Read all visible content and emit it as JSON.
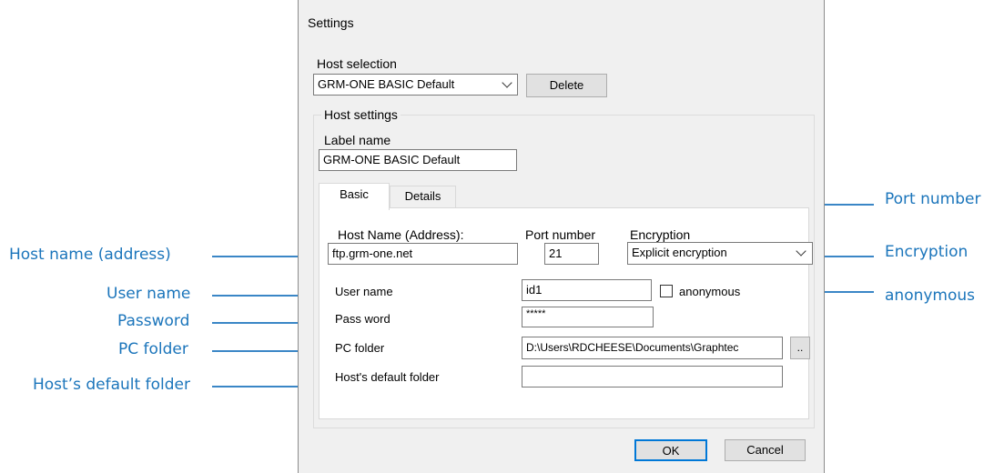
{
  "dialog": {
    "title": "Settings",
    "host_selection_label": "Host selection",
    "host_selection_value": "GRM-ONE BASIC Default",
    "delete_label": "Delete",
    "host_settings_label": "Host settings",
    "label_name_label": "Label name",
    "label_name_value": "GRM-ONE BASIC Default",
    "tabs": [
      {
        "label": "Basic",
        "active": true
      },
      {
        "label": "Details",
        "active": false
      }
    ],
    "host_name_label": "Host Name (Address):",
    "host_name_value": "ftp.grm-one.net",
    "port_label": "Port number",
    "port_value": "21",
    "encryption_label": "Encryption",
    "encryption_value": "Explicit encryption",
    "user_name_label": "User name",
    "user_name_value": "id1",
    "anonymous_label": "anonymous",
    "anonymous_checked": false,
    "password_label": "Pass word",
    "password_value": "*****",
    "pc_folder_label": "PC folder",
    "pc_folder_value": "D:\\Users\\RDCHEESE\\Documents\\Graphtec",
    "browse_label": "..",
    "host_default_folder_label": "Host's default folder",
    "host_default_folder_value": "",
    "ok_label": "OK",
    "cancel_label": "Cancel"
  },
  "callouts": {
    "port_number": "Port number",
    "host_name": "Host name (address)",
    "encryption": "Encryption",
    "user_name": "User name",
    "anonymous": "anonymous",
    "password": "Password",
    "pc_folder": "PC folder",
    "host_default_folder": "Host’s default folder"
  },
  "colors": {
    "callout_text": "#1b75bb",
    "callout_line": "#3a86c6",
    "dialog_bg": "#f0f0f0",
    "ok_border": "#0078d7"
  }
}
